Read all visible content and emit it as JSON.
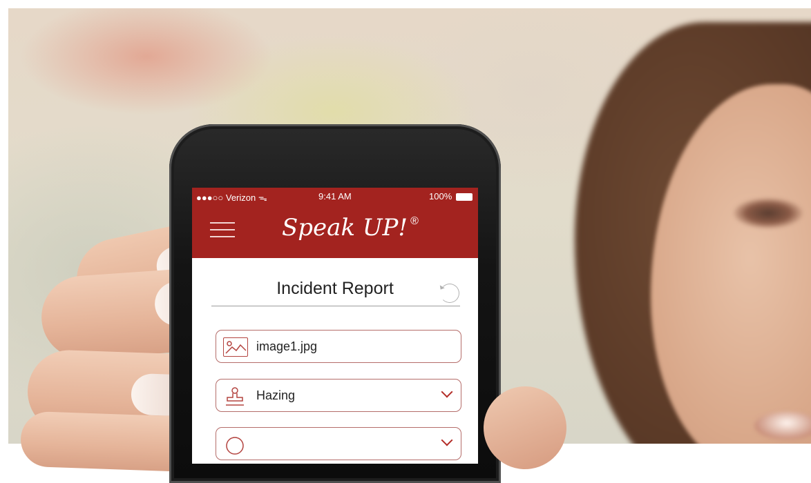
{
  "status_bar": {
    "carrier": "●●●○○ Verizon ᯓ",
    "time": "9:41 AM",
    "battery": "100%"
  },
  "app": {
    "title": "Speak UP!",
    "trademark": "®",
    "accent_color": "#a3231f"
  },
  "form": {
    "heading": "Incident Report",
    "fields": [
      {
        "icon": "image-icon",
        "value": "image1.jpg"
      },
      {
        "icon": "stamp-icon",
        "value": "Hazing",
        "has_dropdown": true
      },
      {
        "icon": "location-icon",
        "value": "",
        "has_dropdown": true
      }
    ]
  },
  "icons": [
    "menu-icon",
    "refresh-icon",
    "image-icon",
    "stamp-icon",
    "chevron-down-icon",
    "location-icon"
  ]
}
